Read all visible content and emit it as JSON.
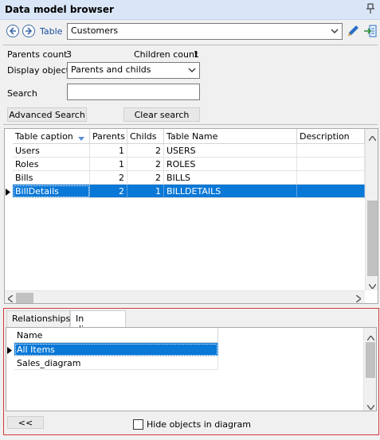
{
  "panel": {
    "title": "Data model browser"
  },
  "toolbar": {
    "table_label": "Table",
    "table_value": "Customers"
  },
  "stats": {
    "parents_label": "Parents count",
    "parents_value": "3",
    "children_label": "Children count",
    "children_value": "1"
  },
  "display": {
    "label": "Display objects",
    "value": "Parents and childs"
  },
  "search": {
    "label": "Search",
    "value": "",
    "advanced_button": "Advanced Search",
    "clear_button": "Clear search"
  },
  "tables_grid": {
    "columns": [
      "Table caption",
      "Parents",
      "Childs",
      "Table Name",
      "Description"
    ],
    "rows": [
      {
        "caption": "Users",
        "parents": "1",
        "childs": "2",
        "name": "USERS",
        "description": ""
      },
      {
        "caption": "Roles",
        "parents": "1",
        "childs": "2",
        "name": "ROLES",
        "description": ""
      },
      {
        "caption": "Bills",
        "parents": "2",
        "childs": "2",
        "name": "BILLS",
        "description": ""
      },
      {
        "caption": "BillDetails",
        "parents": "2",
        "childs": "1",
        "name": "BILLDETAILS",
        "description": ""
      }
    ],
    "selected_row": 3
  },
  "bottom_tabs": {
    "tabs": [
      "Relationships",
      "In diagram"
    ],
    "active": 1
  },
  "diagram_grid": {
    "column": "Name",
    "rows": [
      "All Items",
      "Sales_diagram"
    ],
    "selected_row": 0
  },
  "footer": {
    "collapse_button": "<<",
    "hide_label": "Hide objects in diagram"
  },
  "colors": {
    "selection": "#0a78d7",
    "titlebar": "#d9e6f7",
    "highlight_border": "#d33a3a"
  }
}
